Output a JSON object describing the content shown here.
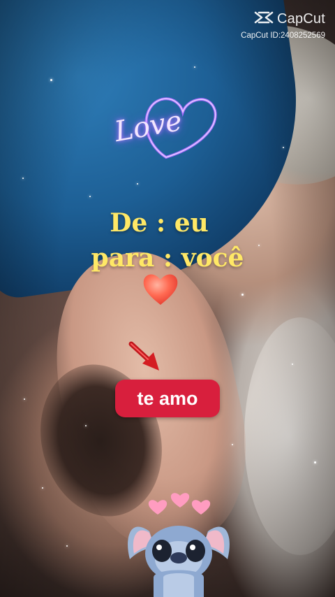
{
  "watermark": {
    "brand": "CapCut",
    "id_text": "CapCut ID:2408252569",
    "icon": "capcut-logo-icon"
  },
  "stickers": {
    "love_text": "Love",
    "love_icon": "neon-heart-icon",
    "heart_icon": "red-heart-icon",
    "arrow_icon": "red-arrow-icon",
    "character_icon": "stitch-character-icon",
    "hearts_icon": "pink-hearts-icon"
  },
  "headline": {
    "line1": "De : eu",
    "line2": "para : você"
  },
  "button": {
    "label": "te amo"
  },
  "colors": {
    "headline": "#ffe866",
    "button_bg": "#d81f3d",
    "neon_heart": "#a66bff",
    "heart": "#ff5a4a"
  }
}
